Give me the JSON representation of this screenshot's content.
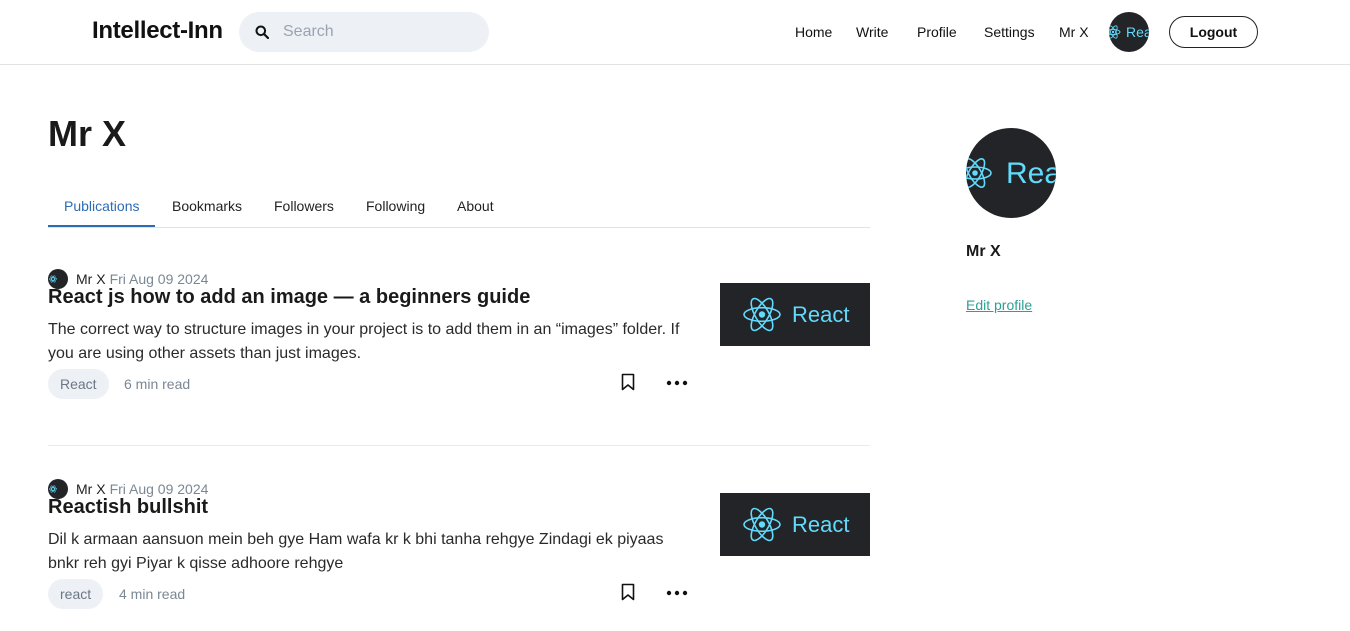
{
  "header": {
    "brand": "Intellect-Inn",
    "search_placeholder": "Search",
    "nav": [
      "Home",
      "Write",
      "Profile",
      "Settings",
      "Mr X"
    ],
    "logout_label": "Logout",
    "avatar_text": "Rea"
  },
  "profile": {
    "name": "Mr X",
    "tabs": [
      "Publications",
      "Bookmarks",
      "Followers",
      "Following",
      "About"
    ],
    "active_tab": "Publications"
  },
  "articles": [
    {
      "author": "Mr X",
      "date": "Fri Aug 09 2024",
      "title": "React js how to add an image — a beginners guide",
      "excerpt": "The correct way to structure images in your project is to add them in an “images” folder. If you are using other assets than just images.",
      "tag": "React",
      "read_time": "6 min read",
      "thumb_text": "React"
    },
    {
      "author": "Mr X",
      "date": "Fri Aug 09 2024",
      "title": "Reactish bullshit",
      "excerpt": "Dil k armaan aansuon mein beh gye Ham wafa kr k bhi tanha rehgye Zindagi ek piyaas bnkr reh gyi Piyar k qisse adhoore rehgye",
      "tag": "react",
      "read_time": "4 min read",
      "thumb_text": "React"
    }
  ],
  "sidebar": {
    "name": "Mr X",
    "avatar_text": "Rea",
    "edit_label": "Edit profile"
  },
  "colors": {
    "accent_tab": "#2d6cb5",
    "link_teal": "#2aa198",
    "react_cyan": "#61dafb",
    "thumb_bg": "#222427"
  },
  "icons": [
    "search-icon",
    "bookmark-icon",
    "more-options-icon",
    "react-logo-icon"
  ]
}
